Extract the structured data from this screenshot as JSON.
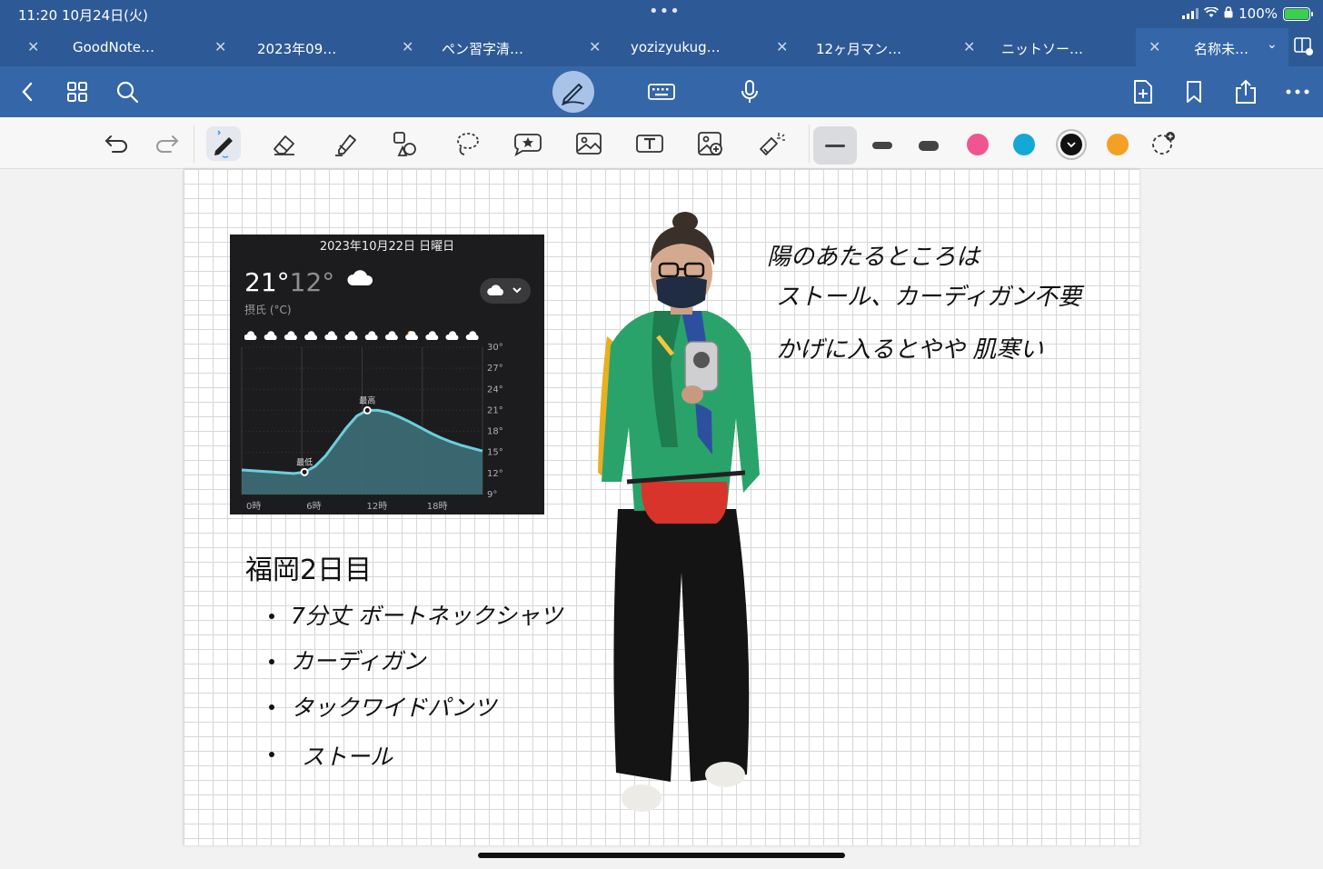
{
  "status": {
    "time_date": "11:20  10月24日(火)",
    "battery": "100%"
  },
  "tabs": [
    {
      "label": "GoodNote…"
    },
    {
      "label": "2023年09…"
    },
    {
      "label": "ペン習字清…"
    },
    {
      "label": "yozizyukug…"
    },
    {
      "label": "12ヶ月マン…"
    },
    {
      "label": "ニットソー…"
    },
    {
      "label": "名称未…"
    }
  ],
  "colors": {
    "header_bg": "#2d5a96",
    "toolbar_bg": "#3566a8",
    "swatch_pink": "#f0558f",
    "swatch_cyan": "#13a8d6",
    "swatch_black": "#111111",
    "swatch_orange": "#f4a025"
  },
  "weather": {
    "date": "2023年10月22日 日曜日",
    "high": "21°",
    "low": "12°",
    "unit": "摂氏 (°C)",
    "label_max": "最高",
    "label_min": "最低"
  },
  "chart_data": {
    "type": "area",
    "x": [
      0,
      1,
      2,
      3,
      4,
      5,
      6,
      7,
      8,
      9,
      10,
      11,
      12,
      13,
      14,
      15,
      16,
      17,
      18,
      19,
      20,
      21,
      22,
      23
    ],
    "values": [
      12.5,
      12.4,
      12.3,
      12.2,
      12.1,
      12,
      12.2,
      13,
      14.5,
      16.5,
      18.5,
      20.2,
      21,
      21,
      20.7,
      20.1,
      19.4,
      18.6,
      17.8,
      17.1,
      16.5,
      16,
      15.6,
      15.2
    ],
    "xticks": [
      "0時",
      "6時",
      "12時",
      "18時"
    ],
    "yticks": [
      "30°",
      "27°",
      "24°",
      "21°",
      "18°",
      "15°",
      "12°",
      "9°"
    ],
    "ylim": [
      9,
      30
    ],
    "ytick_values": [
      30,
      27,
      24,
      21,
      18,
      15,
      12,
      9
    ]
  },
  "notes": {
    "title": "福岡2日目",
    "items": [
      "7分丈 ボートネックシャツ",
      "カーディガン",
      "タックワイドパンツ",
      "ストール"
    ],
    "side": [
      "陽のあたるところは",
      "ストール、カーディガン不要",
      "かげに入るとやや 肌寒い"
    ]
  }
}
